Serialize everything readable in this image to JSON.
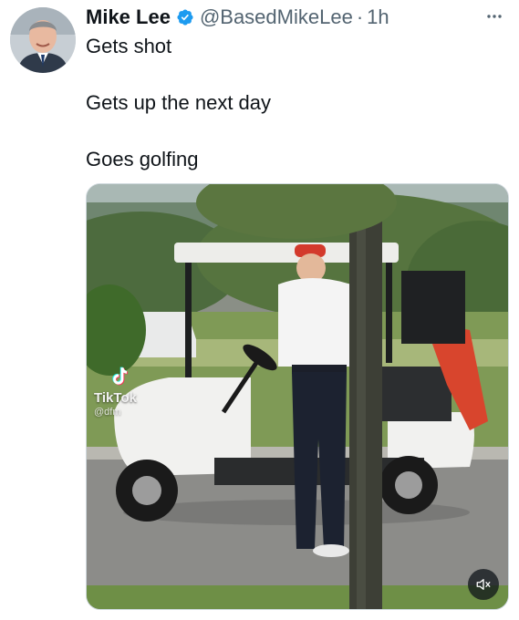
{
  "author": {
    "name": "Mike Lee",
    "handle": "@BasedMikeLee",
    "separator": "·",
    "time": "1h",
    "avatar_icon": "profile-photo",
    "verified_icon": "verified-badge-icon",
    "verified_color": "#1d9bf0"
  },
  "tweet": {
    "lines": [
      "Gets shot",
      "Gets up the next day",
      "Goes golfing"
    ]
  },
  "media": {
    "type": "video",
    "watermark_brand": "TikTok",
    "watermark_user": "@dfm",
    "mute_icon": "volume-muted-icon"
  },
  "actions": {
    "more_icon": "more-options-icon"
  }
}
